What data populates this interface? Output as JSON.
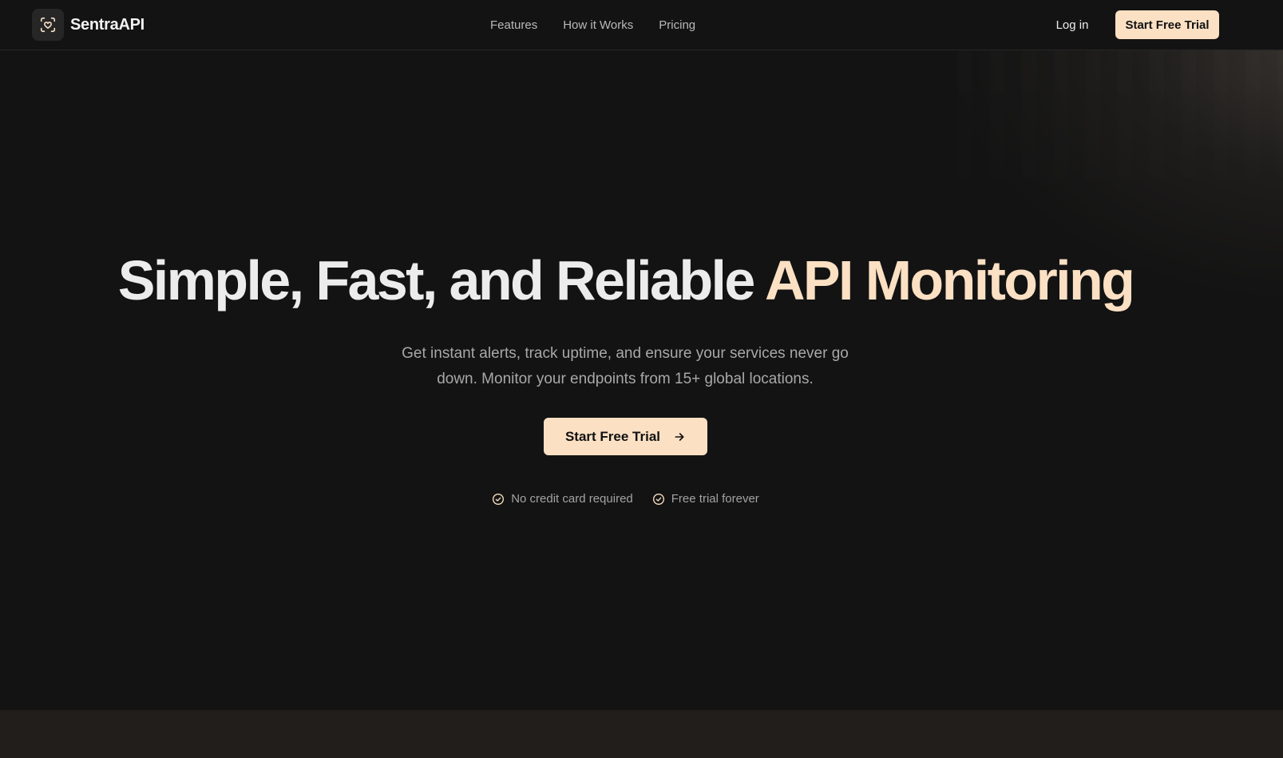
{
  "brand": {
    "name": "SentraAPI",
    "logo_icon": "heart-scan-icon"
  },
  "nav": {
    "links": [
      {
        "label": "Features"
      },
      {
        "label": "How it Works"
      },
      {
        "label": "Pricing"
      }
    ],
    "login_label": "Log in",
    "cta_label": "Start Free Trial"
  },
  "hero": {
    "headline_main": "Simple, Fast, and Reliable",
    "headline_accent": "API Monitoring",
    "subtitle": "Get instant alerts, track uptime, and ensure your services never go down. Monitor your endpoints from 15+ global locations.",
    "cta_label": "Start Free Trial",
    "cta_icon": "arrow-right-icon",
    "perks": [
      {
        "label": "No credit card required",
        "icon": "check-circle-icon"
      },
      {
        "label": "Free trial forever",
        "icon": "check-circle-icon"
      }
    ]
  },
  "colors": {
    "background": "#131313",
    "accent": "#fbe0c3",
    "text": "#ececec",
    "muted_text": "#a8a8a8",
    "next_section_bg": "#221e1b"
  }
}
